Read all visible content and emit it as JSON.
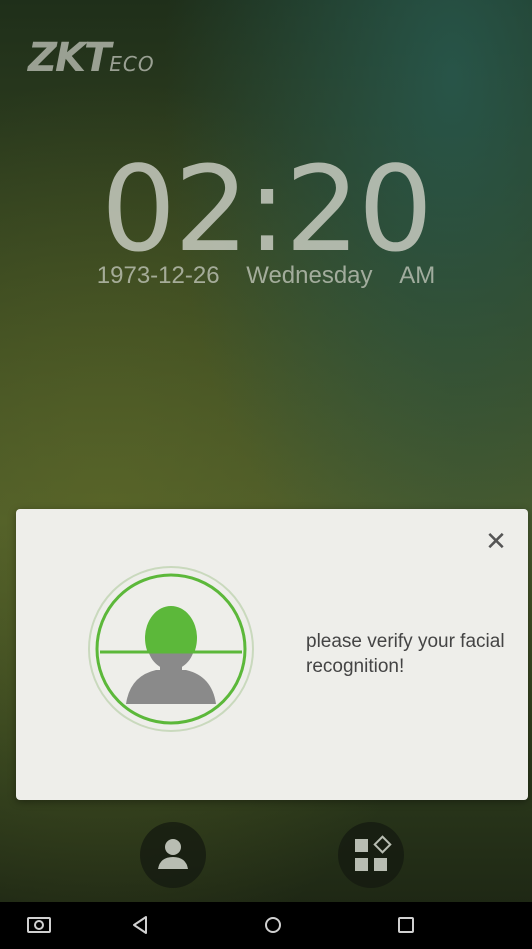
{
  "brand": {
    "logo_main": "ZKT",
    "logo_sub": "ECO"
  },
  "clock": {
    "time": "02:20",
    "date": "1973-12-26",
    "weekday": "Wednesday",
    "period": "AM"
  },
  "dialog": {
    "message": "please verify your facial recognition!",
    "close_icon": "close-icon",
    "illustration": "face-scan-icon"
  },
  "dock": {
    "left_icon": "user-icon",
    "right_icon": "apps-menu-icon"
  },
  "navbar": {
    "icons": [
      "camera-icon",
      "back-icon",
      "home-icon",
      "recent-apps-icon"
    ]
  },
  "colors": {
    "accent_green": "#5cb83a",
    "dialog_bg": "#eeeeea",
    "text_light": "#c7cbc0"
  }
}
